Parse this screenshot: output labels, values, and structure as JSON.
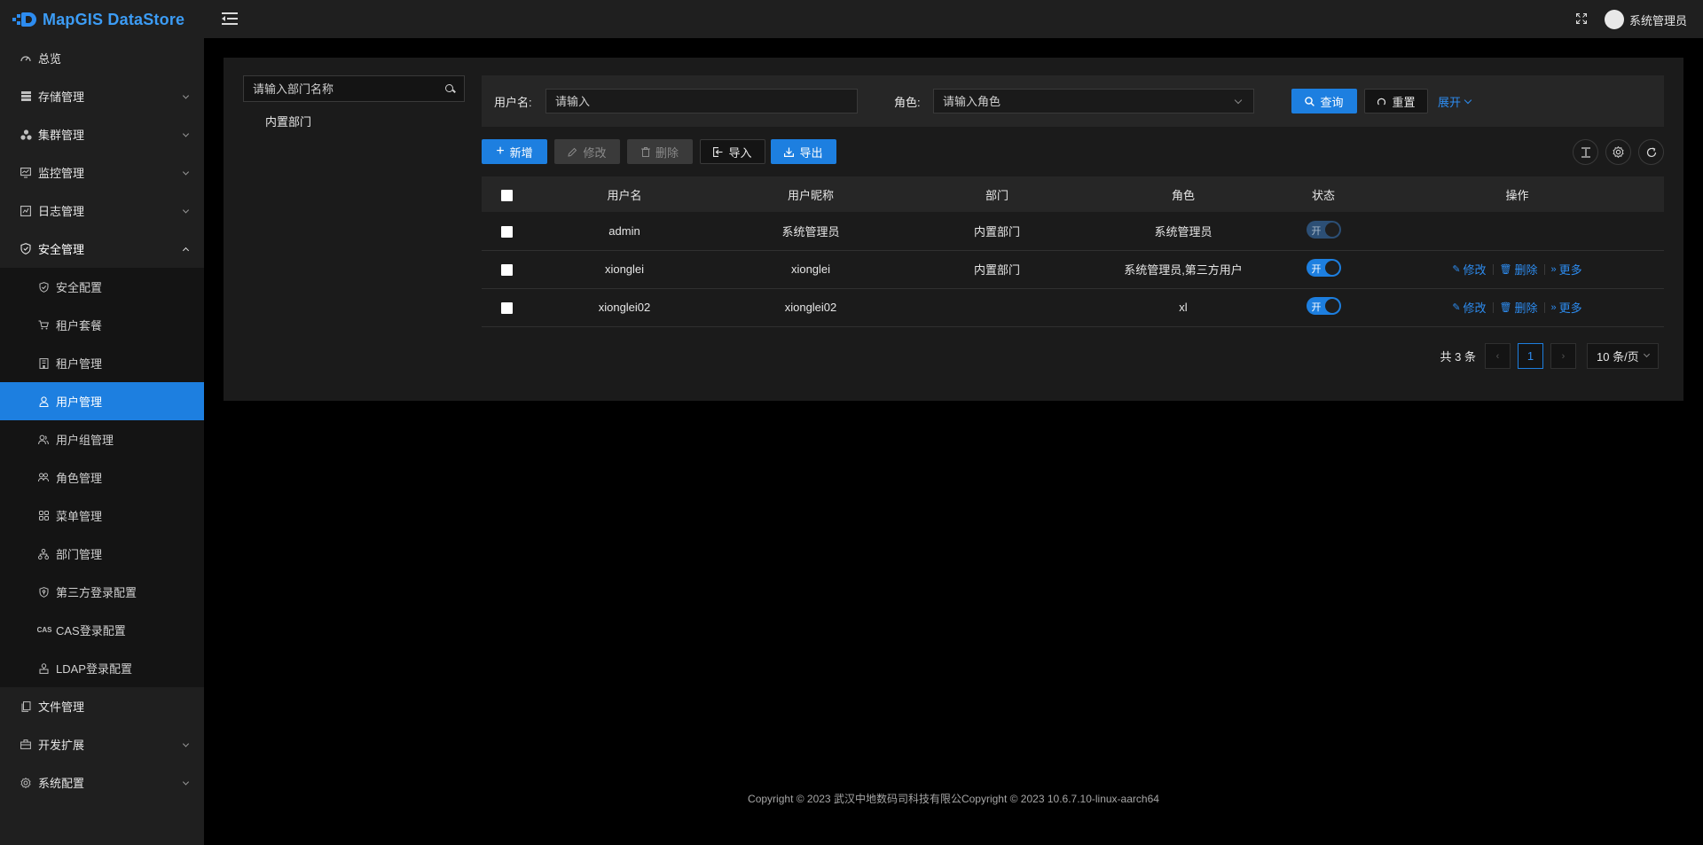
{
  "app": {
    "name": "MapGIS DataStore"
  },
  "sidebar": {
    "items": [
      {
        "label": "总览",
        "icon": "dashboard-icon",
        "has_children": false
      },
      {
        "label": "存储管理",
        "icon": "storage-icon",
        "has_children": true
      },
      {
        "label": "集群管理",
        "icon": "cluster-icon",
        "has_children": true
      },
      {
        "label": "监控管理",
        "icon": "monitor-icon",
        "has_children": true
      },
      {
        "label": "日志管理",
        "icon": "log-icon",
        "has_children": true
      },
      {
        "label": "安全管理",
        "icon": "shield-icon",
        "has_children": true,
        "expanded": true
      },
      {
        "label": "文件管理",
        "icon": "file-icon",
        "has_children": false
      },
      {
        "label": "开发扩展",
        "icon": "toolbox-icon",
        "has_children": true
      },
      {
        "label": "系统配置",
        "icon": "gear-icon",
        "has_children": true
      }
    ],
    "security_sub": [
      {
        "label": "安全配置",
        "icon": "shield-check-icon"
      },
      {
        "label": "租户套餐",
        "icon": "cart-icon"
      },
      {
        "label": "租户管理",
        "icon": "building-icon"
      },
      {
        "label": "用户管理",
        "icon": "user-icon",
        "active": true
      },
      {
        "label": "用户组管理",
        "icon": "user-group-icon"
      },
      {
        "label": "角色管理",
        "icon": "role-icon"
      },
      {
        "label": "菜单管理",
        "icon": "menu-grid-icon"
      },
      {
        "label": "部门管理",
        "icon": "org-tree-icon"
      },
      {
        "label": "第三方登录配置",
        "icon": "shield-key-icon"
      },
      {
        "label": "CAS登录配置",
        "icon": "cas-icon"
      },
      {
        "label": "LDAP登录配置",
        "icon": "ldap-icon"
      }
    ]
  },
  "header": {
    "user_name": "系统管理员"
  },
  "tree": {
    "search_placeholder": "请输入部门名称",
    "root_node": "内置部门"
  },
  "filter": {
    "username_label": "用户名:",
    "username_placeholder": "请输入",
    "role_label": "角色:",
    "role_placeholder": "请输入角色",
    "query_label": "查询",
    "reset_label": "重置",
    "expand_label": "展开"
  },
  "toolbar": {
    "add_label": "新增",
    "edit_label": "修改",
    "delete_label": "删除",
    "import_label": "导入",
    "export_label": "导出"
  },
  "table": {
    "columns": [
      "用户名",
      "用户昵称",
      "部门",
      "角色",
      "状态",
      "操作"
    ],
    "rows": [
      {
        "username": "admin",
        "nickname": "系统管理员",
        "dept": "内置部门",
        "role": "系统管理员",
        "status": "开",
        "status_on": true,
        "editable": false
      },
      {
        "username": "xionglei",
        "nickname": "xionglei",
        "dept": "内置部门",
        "role": "系统管理员,第三方用户",
        "status": "开",
        "status_on": true,
        "editable": true
      },
      {
        "username": "xionglei02",
        "nickname": "xionglei02",
        "dept": "",
        "role": "xl",
        "status": "开",
        "status_on": true,
        "editable": true
      }
    ],
    "row_actions": {
      "edit": "修改",
      "delete": "删除",
      "more": "更多"
    }
  },
  "pagination": {
    "total": "共 3 条",
    "current_page": "1",
    "page_size": "10 条/页"
  },
  "footer": {
    "text": "Copyright © 2023 武汉中地数码司科技有限公Copyright © 2023 10.6.7.10-linux-aarch64"
  },
  "colors": {
    "accent": "#1d7fe0",
    "link": "#2d8cf0",
    "sidebar_bg": "#1f1f1f",
    "page_bg": "#000000"
  }
}
